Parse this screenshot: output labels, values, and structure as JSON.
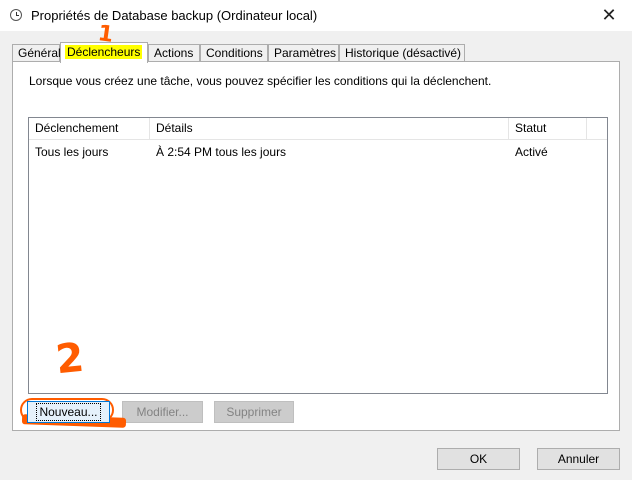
{
  "window": {
    "title": "Propriétés de Database backup (Ordinateur local)",
    "close_glyph": "✕",
    "icon": "task-clock-icon"
  },
  "tabs": [
    {
      "label": "Général",
      "active": false
    },
    {
      "label": "Déclencheurs",
      "active": true
    },
    {
      "label": "Actions",
      "active": false
    },
    {
      "label": "Conditions",
      "active": false
    },
    {
      "label": "Paramètres",
      "active": false
    },
    {
      "label": "Historique (désactivé)",
      "active": false
    }
  ],
  "panel": {
    "intro": "Lorsque vous créez une tâche, vous pouvez spécifier les conditions qui la déclenchent."
  },
  "triggers_table": {
    "columns": [
      "Déclenchement",
      "Détails",
      "Statut"
    ],
    "rows": [
      {
        "trigger": "Tous les jours",
        "details": "À 2:54 PM tous les jours",
        "status": "Activé"
      }
    ]
  },
  "buttons": {
    "new": "Nouveau...",
    "edit": "Modifier...",
    "delete": "Supprimer",
    "ok": "OK",
    "cancel": "Annuler"
  },
  "annotations": {
    "step1": "1",
    "step2": "2",
    "color": "#ff5c00",
    "highlight": "#ffff00"
  }
}
